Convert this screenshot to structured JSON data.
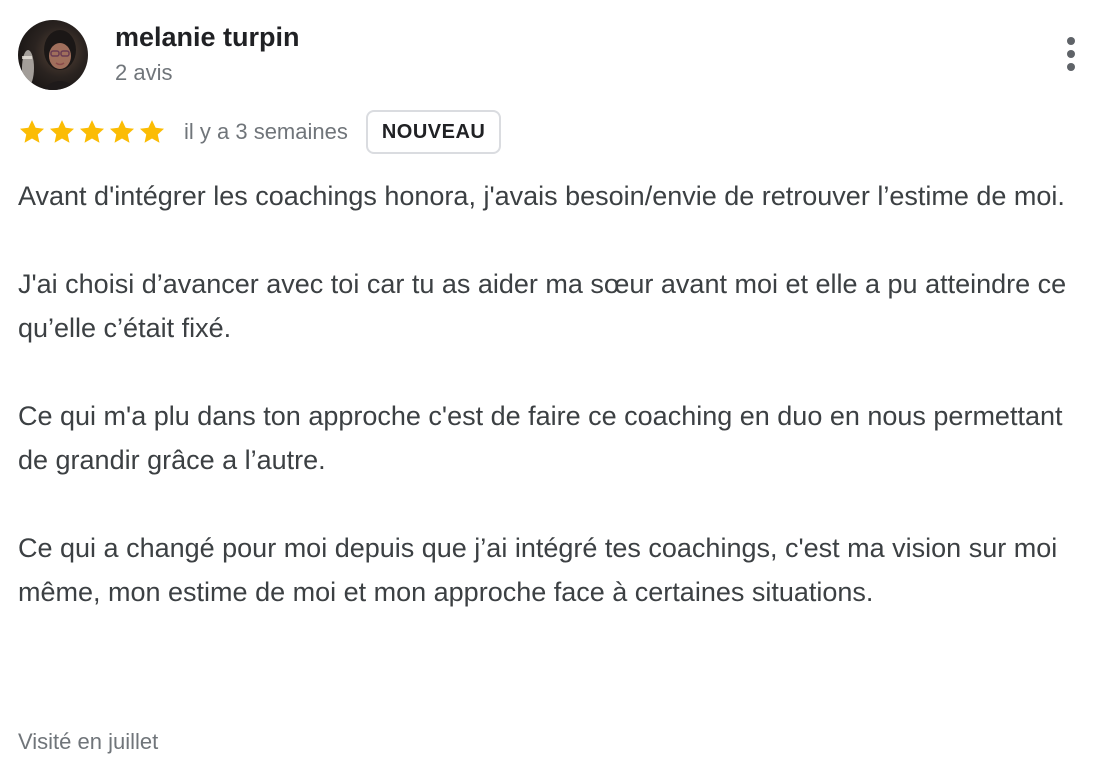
{
  "review": {
    "author": {
      "name": "melanie turpin",
      "meta": "2 avis"
    },
    "rating": {
      "stars": 5,
      "max": 5,
      "color": "#fbbc04"
    },
    "date": "il y a 3 semaines",
    "badge": "NOUVEAU",
    "paragraphs": [
      "Avant d'intégrer les coachings honora, j'avais besoin/envie de retrouver l’estime de moi.",
      "J'ai choisi d’avancer avec toi car tu as aider ma sœur avant moi et elle a pu atteindre ce qu’elle c’était fixé.",
      "Ce qui m'a plu dans ton approche c'est de faire ce coaching en duo en nous permettant de grandir grâce a l’autre.",
      "Ce qui a changé pour moi depuis que j’ai intégré tes coachings, c'est ma vision sur moi même, mon estime de moi et mon approche face à certaines situations."
    ],
    "visit": "Visité en juillet"
  },
  "icons": {
    "more": "more-vert-icon",
    "star": "star-icon"
  }
}
